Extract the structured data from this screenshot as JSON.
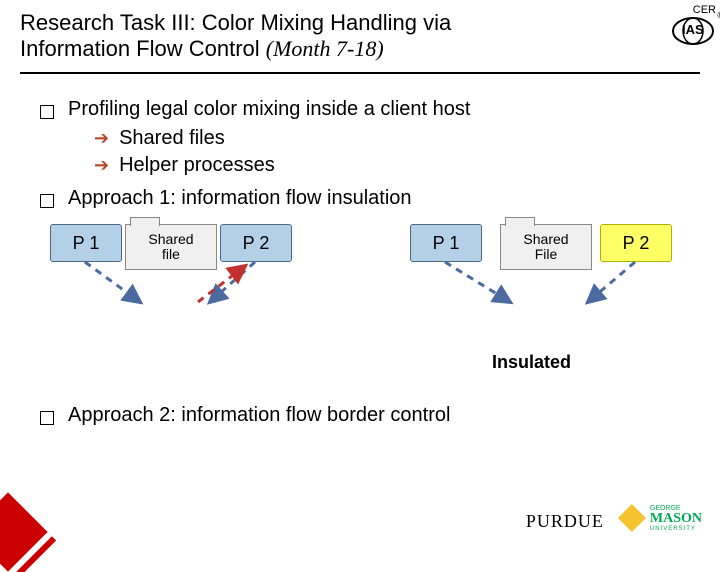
{
  "title": {
    "line1": "Research Task III: Color Mixing Handling via",
    "line2_plain": "Information Flow Control ",
    "line2_italic": "(Month 7-18)"
  },
  "topLogo": {
    "cer": "CER",
    "ias": "IAS",
    "reg": "®"
  },
  "bullets": {
    "b1": "Profiling legal color mixing inside a client host",
    "b1_sub1": "Shared files",
    "b1_sub2": "Helper processes",
    "b2": "Approach 1: information flow insulation",
    "b3": "Approach 2: information flow border control"
  },
  "diagram": {
    "p1_left": "P 1",
    "p2_left": "P 2",
    "shared_left": "Shared\nfile",
    "p1_right": "P 1",
    "p2_right": "P 2",
    "shared_right": "Shared\nFile",
    "insulated": "Insulated"
  },
  "footer": {
    "purdue": "PURDUE",
    "mason_top": "GEORGE",
    "mason_big": "MASON",
    "mason_bot": "UNIVERSITY"
  },
  "colors": {
    "blue": "#b3d0e7",
    "yellow": "#ffff66",
    "red": "#c00",
    "arrowBullet": "#b44a2a"
  }
}
